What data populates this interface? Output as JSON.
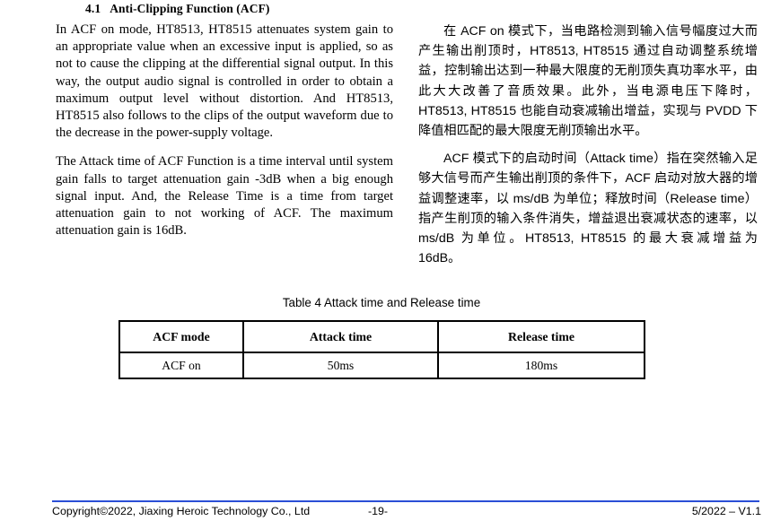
{
  "heading": {
    "number": "4.1",
    "title": "Anti-Clipping Function (ACF)"
  },
  "left_column": {
    "paragraphs": [
      "In ACF on mode, HT8513, HT8515 attenuates system gain to an appropriate value when an excessive input is applied, so as not to cause the clipping at the differential signal output. In this way, the output audio signal is controlled in order to obtain a maximum output level without distortion. And HT8513, HT8515 also follows to the clips of the output waveform due to the decrease in the power-supply voltage.",
      "The Attack time of ACF Function is a time interval until system gain falls to target attenuation gain -3dB when a big enough signal input. And, the Release Time is a time from target attenuation gain to not working of ACF. The maximum attenuation gain is 16dB."
    ]
  },
  "right_column": {
    "paragraphs": [
      "在 ACF on 模式下，当电路检测到输入信号幅度过大而产生输出削顶时，HT8513, HT8515 通过自动调整系统增益，控制输出达到一种最大限度的无削顶失真功率水平，由此大大改善了音质效果。此外，当电源电压下降时，HT8513, HT8515 也能自动衰减输出增益，实现与 PVDD 下降值相匹配的最大限度无削顶输出水平。",
      "ACF 模式下的启动时间（Attack time）指在突然输入足够大信号而产生输出削顶的条件下，ACF 启动对放大器的增益调整速率，以 ms/dB 为单位；释放时间（Release time）指产生削顶的输入条件消失，增益退出衰减状态的速率，以 ms/dB 为单位。HT8513, HT8515 的最大衰减增益为 16dB。"
    ]
  },
  "table": {
    "caption": "Table 4 Attack time and Release time",
    "headers": [
      "ACF mode",
      "Attack time",
      "Release time"
    ],
    "rows": [
      [
        "ACF on",
        "50ms",
        "180ms"
      ]
    ]
  },
  "footer": {
    "copyright": "Copyright©2022, Jiaxing Heroic Technology Co., Ltd",
    "page_number": "-19-",
    "version": "5/2022 – V1.1",
    "rule_color": "#2b4ed6"
  }
}
